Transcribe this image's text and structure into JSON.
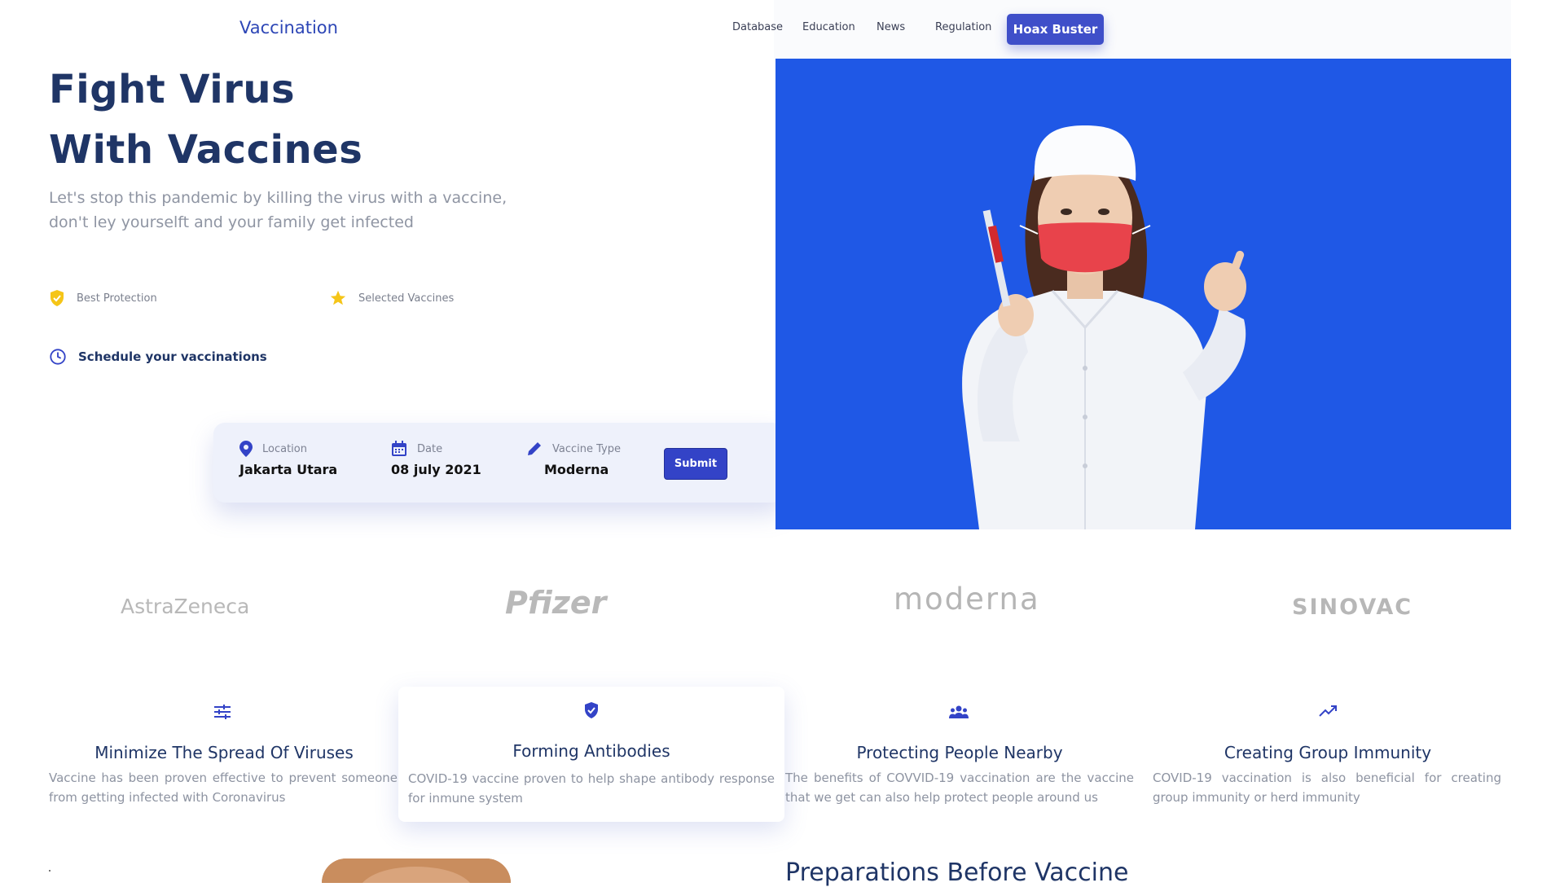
{
  "header": {
    "brand": "Vaccination",
    "nav": [
      "Database",
      "Education",
      "News",
      "Regulation"
    ],
    "cta": "Hoax Buster"
  },
  "hero": {
    "title_line1": "Fight Virus",
    "title_line2": "With Vaccines",
    "subtitle": "Let's stop this pandemic by killing the virus with a vaccine, don't ley yourselft and your family get infected",
    "features": [
      "Best Protection",
      "Selected Vaccines"
    ],
    "schedule_label": "Schedule your vaccinations"
  },
  "booking": {
    "location_label": "Location",
    "location_value": "Jakarta Utara",
    "date_label": "Date",
    "date_value": "08 july 2021",
    "type_label": "Vaccine Type",
    "type_value": "Moderna",
    "submit_label": "Submit"
  },
  "partners": [
    "AstraZeneca",
    "Pfizer",
    "moderna",
    "SINOVAC"
  ],
  "benefits": [
    {
      "title": "Minimize The Spread Of Viruses",
      "desc": "Vaccine has been proven effective to prevent someone from getting infected with Coronavirus"
    },
    {
      "title": "Forming Antibodies",
      "desc": "COVID-19 vaccine proven to help shape antibody response for inmune system"
    },
    {
      "title": "Protecting People Nearby",
      "desc": "The benefits of COVVID-19 vaccination are the vaccine that we get can also help protect people around us"
    },
    {
      "title": "Creating Group Immunity",
      "desc": "COVID-19 vaccination is also beneficial for creating group immunity or herd immunity"
    }
  ],
  "next_section": {
    "heading": "Preparations Before Vaccine"
  },
  "colors": {
    "primary": "#3f4fc9",
    "heading": "#1f3566",
    "accent": "#f5c518",
    "hero_bg": "#1f58e6"
  }
}
